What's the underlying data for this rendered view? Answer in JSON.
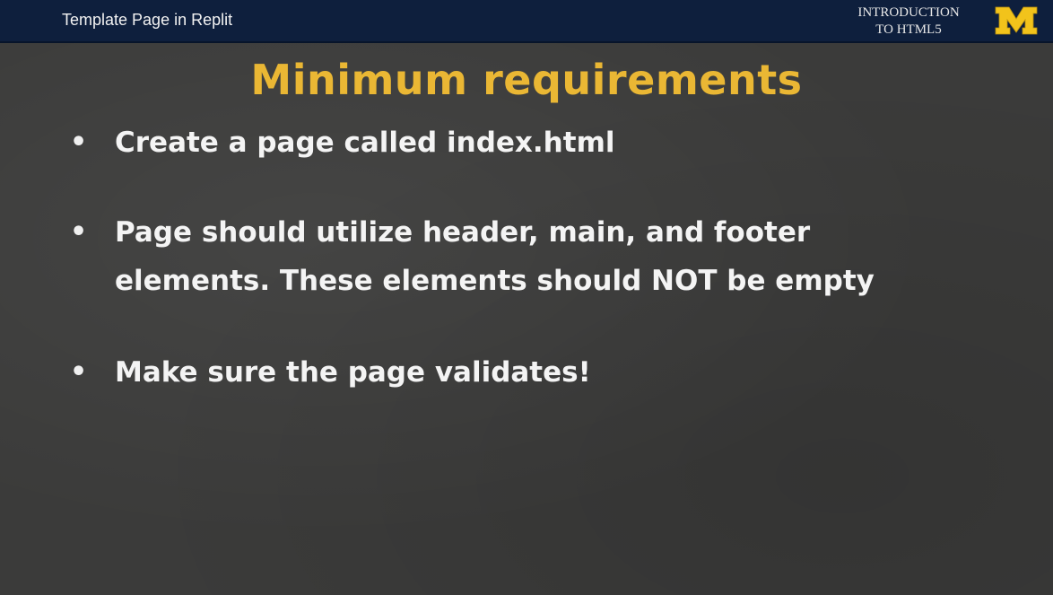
{
  "header": {
    "title": "Template Page in Replit",
    "course_label": "INTRODUCTION\nTO HTML5",
    "logo_letter": "M",
    "logo_color": "#f2c31b"
  },
  "slide": {
    "heading": "Minimum requirements",
    "heading_color": "#eab734",
    "bullets": [
      {
        "text": "Create a page called index.html"
      },
      {
        "text": "Page should utilize header, main, and footer\nelements.  These elements should NOT be empty"
      },
      {
        "text": "Make sure the page validates!"
      }
    ]
  }
}
